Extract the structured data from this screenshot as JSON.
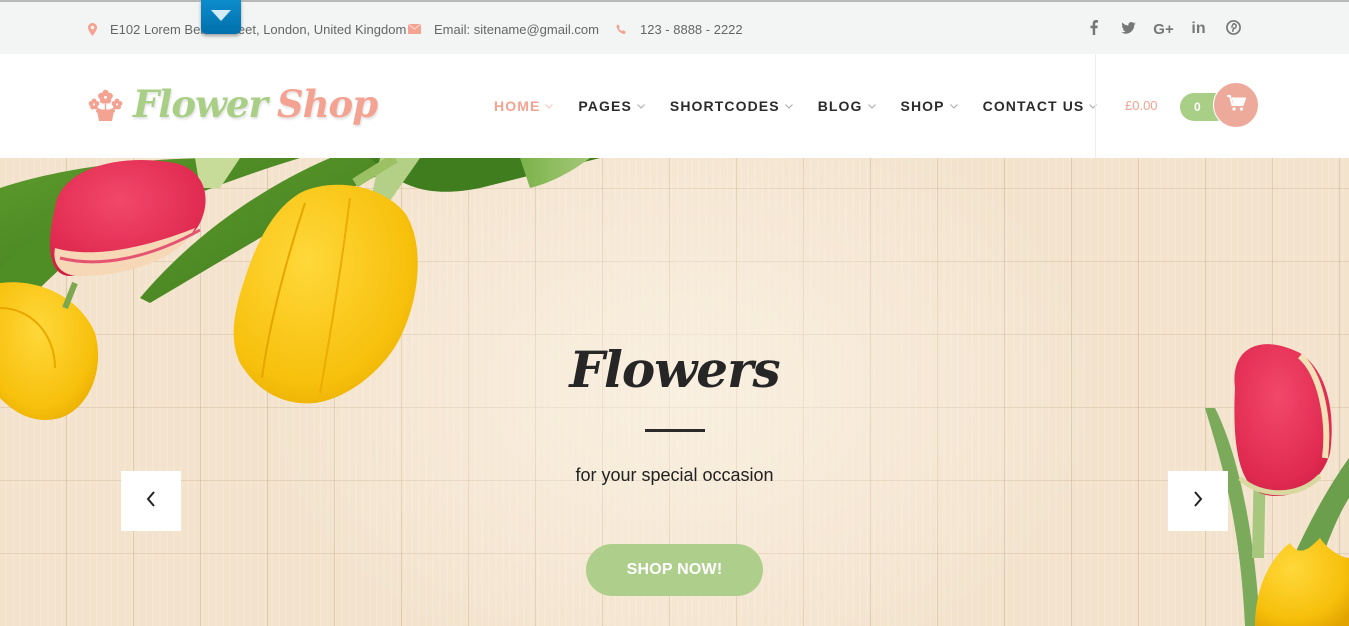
{
  "topbar": {
    "address": {
      "icon": "map-marker-icon",
      "text": "E102 Lorem Berlin Street, London, United Kingdom"
    },
    "email": {
      "icon": "envelope-icon",
      "text": "Email: sitename@gmail.com"
    },
    "phone": {
      "icon": "phone-icon",
      "text": "123 - 8888 - 2222"
    },
    "social": [
      {
        "name": "facebook",
        "icon": "facebook-icon",
        "glyph": "f"
      },
      {
        "name": "twitter",
        "icon": "twitter-icon",
        "glyph": ""
      },
      {
        "name": "google-plus",
        "icon": "google-plus-icon",
        "glyph": "G+"
      },
      {
        "name": "linkedin",
        "icon": "linkedin-icon",
        "glyph": "in"
      },
      {
        "name": "pinterest",
        "icon": "pinterest-icon",
        "glyph": ""
      }
    ]
  },
  "header": {
    "logo": {
      "word1": "Flower",
      "word2": "Shop",
      "icon": "flower-pot-icon"
    },
    "nav": [
      {
        "label": "HOME",
        "active": true
      },
      {
        "label": "PAGES",
        "active": false
      },
      {
        "label": "SHORTCODES",
        "active": false
      },
      {
        "label": "BLOG",
        "active": false
      },
      {
        "label": "SHOP",
        "active": false
      },
      {
        "label": "CONTACT US",
        "active": false
      }
    ],
    "cart": {
      "total": "£0.00",
      "count": "0",
      "icon": "shopping-cart-icon"
    }
  },
  "hero": {
    "title": "Flowers",
    "subtitle": "for your special occasion",
    "cta_label": "SHOP NOW!",
    "prev_icon": "chevron-left-icon",
    "next_icon": "chevron-right-icon"
  },
  "colors": {
    "accent_pink": "#f4a292",
    "accent_green": "#a9cf87",
    "topbar_bg": "#f2f5f4",
    "text_dark": "#2b2b2b"
  }
}
